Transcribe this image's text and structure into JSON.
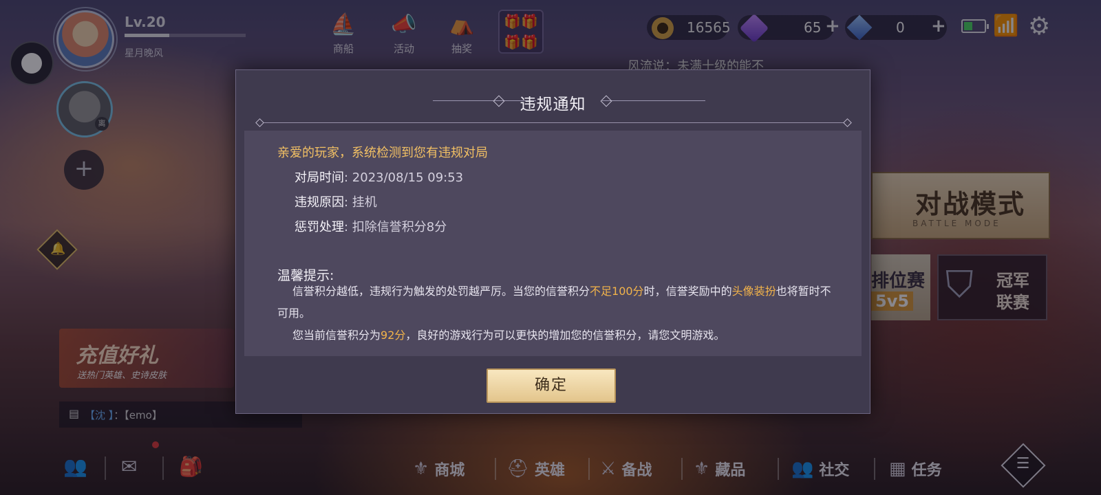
{
  "profile": {
    "level": "Lv.20",
    "level_progress": 0.37,
    "nickname": "星月晚风",
    "friend_badge": "离"
  },
  "top_nav": [
    {
      "label": "商船",
      "icon": "ship-icon"
    },
    {
      "label": "活动",
      "icon": "megaphone-icon"
    },
    {
      "label": "抽奖",
      "icon": "draw-icon"
    }
  ],
  "currency": {
    "coins": "16565",
    "gems": "65",
    "diamonds": "0",
    "plus": "+"
  },
  "ticker": "风流说：未满十级的能不",
  "recharge": {
    "title": "充值好礼",
    "subtitle": "送热门英雄、史诗皮肤"
  },
  "chat": {
    "sender": "【沈 】",
    "sep": "：",
    "message": "【emo】"
  },
  "battle_mode": {
    "title": "对战模式",
    "subtitle": "BATTLE MODE"
  },
  "ranked": {
    "title": "排位赛",
    "mode": "5v5"
  },
  "champion": {
    "title": "冠军联赛"
  },
  "bottom_nav": [
    {
      "label": "商城",
      "icon": "shop-icon"
    },
    {
      "label": "英雄",
      "icon": "helmet-icon"
    },
    {
      "label": "备战",
      "icon": "prepare-icon"
    },
    {
      "label": "藏品",
      "icon": "collection-icon"
    },
    {
      "label": "社交",
      "icon": "social-icon"
    },
    {
      "label": "任务",
      "icon": "task-icon"
    }
  ],
  "modal": {
    "title": "违规通知",
    "greeting": "亲爱的玩家，系统检测到您有违规对局",
    "fields": [
      {
        "key": "对局时间",
        "value": ": 2023/08/15 09:53"
      },
      {
        "key": "违规原因",
        "value": ": 挂机"
      },
      {
        "key": "惩罚处理",
        "value": ": 扣除信誉积分8分"
      }
    ],
    "tip_heading": "温馨提示:",
    "tip1_a": "信誉积分越低，违规行为触发的处罚越严厉。当您的信誉积分",
    "tip1_b": "不足100分",
    "tip1_c": "时，信誉奖励中的",
    "tip1_d": "头像装扮",
    "tip1_e": "也将暂时不可用。",
    "tip2_a": "您当前信誉积分为",
    "tip2_b": "92分",
    "tip2_c": "，良好的游戏行为可以更快的增加您的信誉积分，请您文明游戏。",
    "confirm": "确定"
  },
  "colors": {
    "highlight": "#f2b34a",
    "modal_bg": "#3f3a4e",
    "button": "#e3c58c"
  }
}
